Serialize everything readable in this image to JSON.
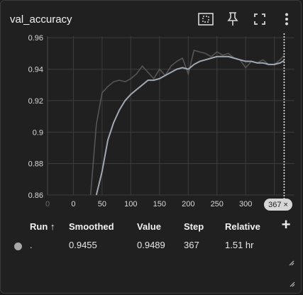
{
  "card": {
    "title": "val_accuracy",
    "icons": [
      "fit-domain-icon",
      "pin-icon",
      "fullscreen-icon",
      "more-vert-icon"
    ]
  },
  "chart_data": {
    "type": "line",
    "xlabel": "",
    "ylabel": "",
    "x_ticks": [
      0,
      50,
      100,
      150,
      200,
      250,
      300,
      350
    ],
    "x_tick_labels": [
      "0",
      "0",
      "50",
      "100",
      "150",
      "200",
      "250",
      "300",
      "350"
    ],
    "y_ticks": [
      0.86,
      0.88,
      0.9,
      0.92,
      0.94,
      0.96
    ],
    "y_tick_labels": [
      "0.86",
      "0.88",
      "0.9",
      "0.92",
      "0.94",
      "0.96"
    ],
    "xlim": [
      -45,
      385
    ],
    "ylim": [
      0.86,
      0.961
    ],
    "grid": true,
    "series": [
      {
        "role": "raw",
        "color": "#555555",
        "x": [
          30,
          40,
          50,
          60,
          70,
          80,
          90,
          100,
          110,
          120,
          130,
          140,
          150,
          160,
          170,
          180,
          190,
          200,
          210,
          220,
          230,
          240,
          250,
          260,
          270,
          280,
          290,
          300,
          310,
          320,
          330,
          340,
          350,
          360,
          367
        ],
        "y": [
          0.86,
          0.905,
          0.925,
          0.929,
          0.932,
          0.933,
          0.932,
          0.934,
          0.937,
          0.942,
          0.938,
          0.934,
          0.94,
          0.936,
          0.942,
          0.945,
          0.947,
          0.937,
          0.952,
          0.951,
          0.95,
          0.948,
          0.951,
          0.949,
          0.95,
          0.947,
          0.946,
          0.941,
          0.945,
          0.944,
          0.946,
          0.943,
          0.943,
          0.946,
          0.9489
        ]
      },
      {
        "role": "smoothed",
        "color": "#9fa8b4",
        "x": [
          40,
          50,
          60,
          70,
          80,
          90,
          100,
          110,
          120,
          130,
          140,
          150,
          160,
          170,
          180,
          190,
          200,
          210,
          220,
          230,
          240,
          250,
          260,
          270,
          280,
          290,
          300,
          310,
          320,
          330,
          340,
          350,
          360,
          367
        ],
        "y": [
          0.86,
          0.875,
          0.895,
          0.906,
          0.914,
          0.92,
          0.924,
          0.927,
          0.93,
          0.933,
          0.933,
          0.934,
          0.936,
          0.938,
          0.94,
          0.941,
          0.94,
          0.943,
          0.945,
          0.946,
          0.947,
          0.948,
          0.948,
          0.948,
          0.947,
          0.946,
          0.945,
          0.945,
          0.944,
          0.944,
          0.943,
          0.943,
          0.944,
          0.9455
        ]
      }
    ],
    "cursor_step": 367
  },
  "cursor": {
    "step_label": "367",
    "close_glyph": "×"
  },
  "table": {
    "headers": {
      "run": "Run ↑",
      "smoothed": "Smoothed",
      "value": "Value",
      "step": "Step",
      "relative": "Relative"
    },
    "add_glyph": "+",
    "rows": [
      {
        "run": ".",
        "smoothed": "0.9455",
        "value": "0.9489",
        "step": "367",
        "relative": "1.51 hr",
        "color": "#a8a8a8"
      }
    ]
  }
}
